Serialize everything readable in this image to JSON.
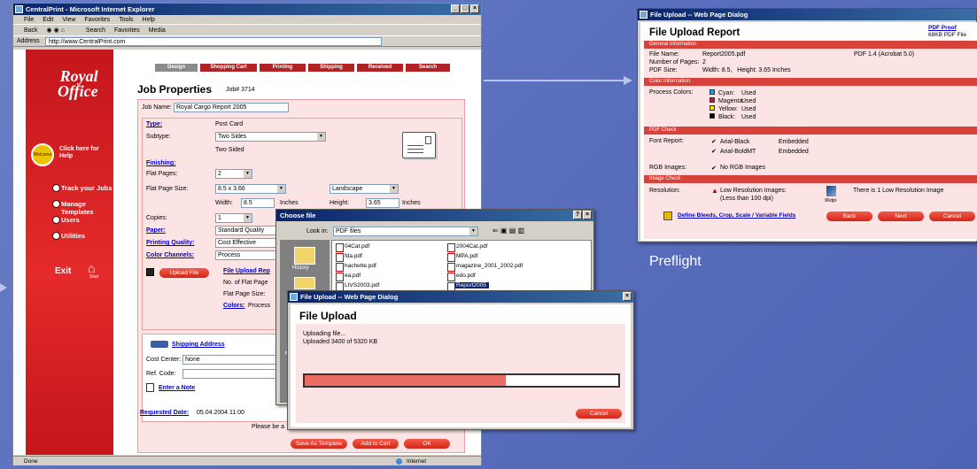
{
  "browser": {
    "title": "CentralPrint - Microsoft Internet Explorer",
    "menu": [
      "File",
      "Edit",
      "View",
      "Favorites",
      "Tools",
      "Help"
    ],
    "toolbar": [
      "Back",
      "Search",
      "Favorites",
      "Media"
    ],
    "address_label": "Address",
    "address": "http://www.CentralPrint.com",
    "status_left": "Done",
    "status_right": "Internet"
  },
  "tabs": [
    "Design",
    "Shopping Cart",
    "Printing",
    "Shipping",
    "Received",
    "Search"
  ],
  "logo": {
    "line1": "Royal",
    "line2": "Office"
  },
  "sidebar": {
    "help": "Click here for Help",
    "help_badge": "Welcome",
    "items": [
      "Track your Jobs",
      "Manage Templates",
      "Users",
      "Utilities"
    ],
    "exit": "Exit",
    "start": "Start"
  },
  "job": {
    "title": "Job Properties",
    "number": "Job# 3714",
    "name_label": "Job Name:",
    "name_value": "Royal Cargo Report 2005",
    "type_label": "Type:",
    "type_value": "Post Card",
    "subtype_label": "Subtype:",
    "subtype_value": "Two Sides",
    "subtype_note": "Two Sided",
    "finishing_label": "Finishing:",
    "flat_pages_label": "Flat Pages:",
    "flat_pages_value": "2",
    "flat_size_label": "Flat Page Size:",
    "flat_size_value": "8.5 x 3.66",
    "orientation_value": "Landscape",
    "width_label": "Width:",
    "width_value": "8.5",
    "height_label": "Height:",
    "height_value": "3.65",
    "inches": "Inches",
    "copies_label": "Copies:",
    "copies_value": "1",
    "paper_label": "Paper:",
    "paper_value": "Standard Quality",
    "quality_label": "Printing Quality:",
    "quality_value": "Cost Effective",
    "channels_label": "Color Channels:",
    "channels_value": "Process",
    "upload_btn": "Upload File",
    "file_upload_rep": "File Upload Rep",
    "no_flat_pages": "No. of Flat Page",
    "flat_page_size": "Flat Page Size:",
    "colors": "Colors:",
    "colors_value": "Process",
    "shipping": "Shipping Address",
    "cost_center_label": "Cost Center:",
    "cost_center_value": "None",
    "ref_code_label": "Ref. Code:",
    "enter_note": "Enter a Note",
    "requested_label": "Requested Date:",
    "requested_value": "05.04.2004 11:00",
    "please": "Please be a",
    "buttons": [
      "Save As Template",
      "Add to Cart",
      "OK"
    ]
  },
  "choose_file": {
    "title": "Choose file",
    "look_in_label": "Look in:",
    "look_in_value": "PDF files",
    "history": "History",
    "files_left": [
      "04Cat.pdf",
      "fda.pdf",
      "hachette.pdf",
      "ea.pdf",
      "LIVS2003.pdf"
    ],
    "files_right": [
      "2004Cat.pdf",
      "MPA.pdf",
      "magazine_2001_2002.pdf",
      "edo.pdf",
      "Report2005"
    ],
    "side_letter": "M"
  },
  "upload": {
    "title": "File Upload -- Web Page Dialog",
    "heading": "File Upload",
    "status1": "Uploading file...",
    "status2": "Uploaded 3400 of 5320 KB",
    "progress": 0.64,
    "cancel": "Cancel"
  },
  "report": {
    "title": "File Upload -- Web Page Dialog",
    "heading": "File Upload Report",
    "pdf_proof": "PDF Proof",
    "pdf_size": "68KB PDF File",
    "general": "General Information",
    "file_name_label": "File Name:",
    "file_name": "Report2005.pdf",
    "pdf_version": "PDF 1.4 (Acrobat 5.0)",
    "pages_label": "Number of Pages:",
    "pages": "2",
    "size_label": "PDF Size:",
    "size": "Width: 8.5,   Height: 3.65 Inches",
    "color_info": "Color Information",
    "process_label": "Process Colors:",
    "process_colors": [
      {
        "name": "Cyan:",
        "status": "Used",
        "color": "#00aeef"
      },
      {
        "name": "Magenta:",
        "status": "Used",
        "color": "#c2185b"
      },
      {
        "name": "Yellow:",
        "status": "Used",
        "color": "#ffe600"
      },
      {
        "name": "Black:",
        "status": "Used",
        "color": "#000000"
      }
    ],
    "pdf_check": "PDF Check",
    "font_label": "Font Report:",
    "fonts": [
      {
        "name": "Arial-Black",
        "status": "Embedded"
      },
      {
        "name": "Arial-BoldMT",
        "status": "Embedded"
      }
    ],
    "rgb_label": "RGB Images:",
    "rgb": "No RGB Images",
    "image_check": "Image Check",
    "resolution_label": "Resolution:",
    "low_res": "Low Resolution Images:",
    "low_res_sub": "(Less than 100 dpi)",
    "dpi": "96dpi",
    "there_is": "There is 1 Low Resolution Image",
    "define": "Define Bleeds, Crop, Scale / Variable Fields",
    "buttons": [
      "Back",
      "Next",
      "Cancel"
    ]
  },
  "caption": "Preflight"
}
